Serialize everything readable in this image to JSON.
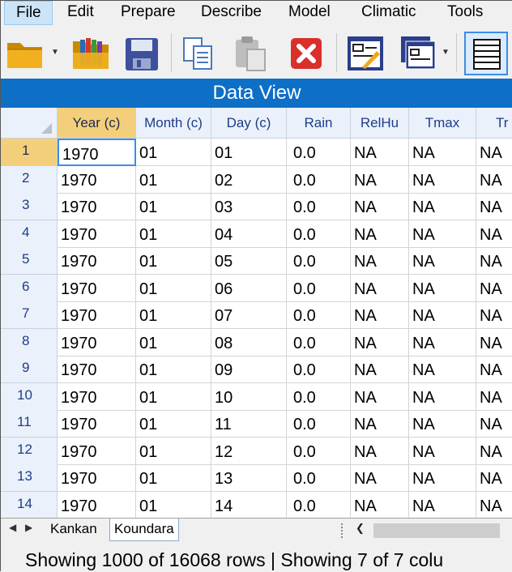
{
  "menu": [
    "File",
    "Edit",
    "Prepare",
    "Describe",
    "Model",
    "Climatic",
    "Tools"
  ],
  "toolbar": {
    "buttons": [
      "open-folder-icon",
      "open-library-icon",
      "save-icon",
      "copy-icon",
      "paste-icon",
      "delete-icon",
      "output-window-icon",
      "windows-layout-icon",
      "data-view-icon"
    ]
  },
  "view_title": "Data View",
  "grid": {
    "columns": [
      "Year (c)",
      "Month (c)",
      "Day (c)",
      "Rain",
      "RelHu",
      "Tmax",
      "Tr"
    ],
    "rows": [
      {
        "num": "1",
        "cells": [
          "1970",
          "01",
          "01",
          "0.0",
          "NA",
          "NA",
          "NA"
        ]
      },
      {
        "num": "2",
        "cells": [
          "1970",
          "01",
          "02",
          "0.0",
          "NA",
          "NA",
          "NA"
        ]
      },
      {
        "num": "3",
        "cells": [
          "1970",
          "01",
          "03",
          "0.0",
          "NA",
          "NA",
          "NA"
        ]
      },
      {
        "num": "4",
        "cells": [
          "1970",
          "01",
          "04",
          "0.0",
          "NA",
          "NA",
          "NA"
        ]
      },
      {
        "num": "5",
        "cells": [
          "1970",
          "01",
          "05",
          "0.0",
          "NA",
          "NA",
          "NA"
        ]
      },
      {
        "num": "6",
        "cells": [
          "1970",
          "01",
          "06",
          "0.0",
          "NA",
          "NA",
          "NA"
        ]
      },
      {
        "num": "7",
        "cells": [
          "1970",
          "01",
          "07",
          "0.0",
          "NA",
          "NA",
          "NA"
        ]
      },
      {
        "num": "8",
        "cells": [
          "1970",
          "01",
          "08",
          "0.0",
          "NA",
          "NA",
          "NA"
        ]
      },
      {
        "num": "9",
        "cells": [
          "1970",
          "01",
          "09",
          "0.0",
          "NA",
          "NA",
          "NA"
        ]
      },
      {
        "num": "10",
        "cells": [
          "1970",
          "01",
          "10",
          "0.0",
          "NA",
          "NA",
          "NA"
        ]
      },
      {
        "num": "11",
        "cells": [
          "1970",
          "01",
          "11",
          "0.0",
          "NA",
          "NA",
          "NA"
        ]
      },
      {
        "num": "12",
        "cells": [
          "1970",
          "01",
          "12",
          "0.0",
          "NA",
          "NA",
          "NA"
        ]
      },
      {
        "num": "13",
        "cells": [
          "1970",
          "01",
          "13",
          "0.0",
          "NA",
          "NA",
          "NA"
        ]
      },
      {
        "num": "14",
        "cells": [
          "1970",
          "01",
          "14",
          "0.0",
          "NA",
          "NA",
          "NA"
        ]
      }
    ]
  },
  "sheet_tabs": [
    "Kankan",
    "Koundara"
  ],
  "status": "Showing 1000 of 16068 rows | Showing 7 of 7 colu",
  "colors": {
    "header_blue": "#0e6fc7",
    "selected_header": "#f4cf7b",
    "active_cell_border": "#3c8de6"
  }
}
